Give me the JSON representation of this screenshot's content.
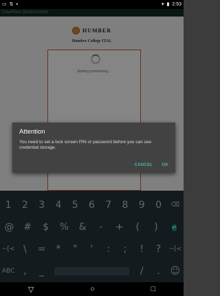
{
  "status_bar": {
    "time": "2:53"
  },
  "app_bar": {
    "title": "ClearPass QuickConnect"
  },
  "page": {
    "logo_text": "HUMBER",
    "college": "Humber College ITAL",
    "progress_text": "Starting provisioning..."
  },
  "dialog": {
    "title": "Attention",
    "message": "You need to set a lock screen PIN or password before you can use credential storage.",
    "cancel_label": "CANCEL",
    "ok_label": "OK"
  },
  "keyboard": {
    "row1": [
      "1",
      "2",
      "3",
      "4",
      "5",
      "6",
      "7",
      "8",
      "9",
      "0",
      "⌫"
    ],
    "row2": [
      "@",
      "#",
      "$",
      "%",
      "&",
      "-",
      "+",
      "(",
      ")",
      "↵"
    ],
    "row3": [
      "~[<",
      "\\",
      "=",
      "*",
      "\"",
      "'",
      ":",
      ";",
      "!",
      "?",
      "~[<"
    ],
    "row4": {
      "abc": "ABC",
      "comma": ",",
      "underscore": "_",
      "slash": "/",
      "period": ".",
      "emoji": "☺"
    }
  },
  "nav_bar": {
    "back": "▽",
    "home": "○",
    "recents": "□"
  },
  "icons": [
    "screen-icon",
    "signal-icon",
    "wifi-icon",
    "battery-icon",
    "backspace-icon",
    "enter-icon",
    "emoji-icon",
    "back-icon",
    "home-icon",
    "recents-icon"
  ],
  "colors": {
    "accent": "#4db6ac",
    "enter_key": "#009688",
    "frame_border": "#b85c2e"
  }
}
